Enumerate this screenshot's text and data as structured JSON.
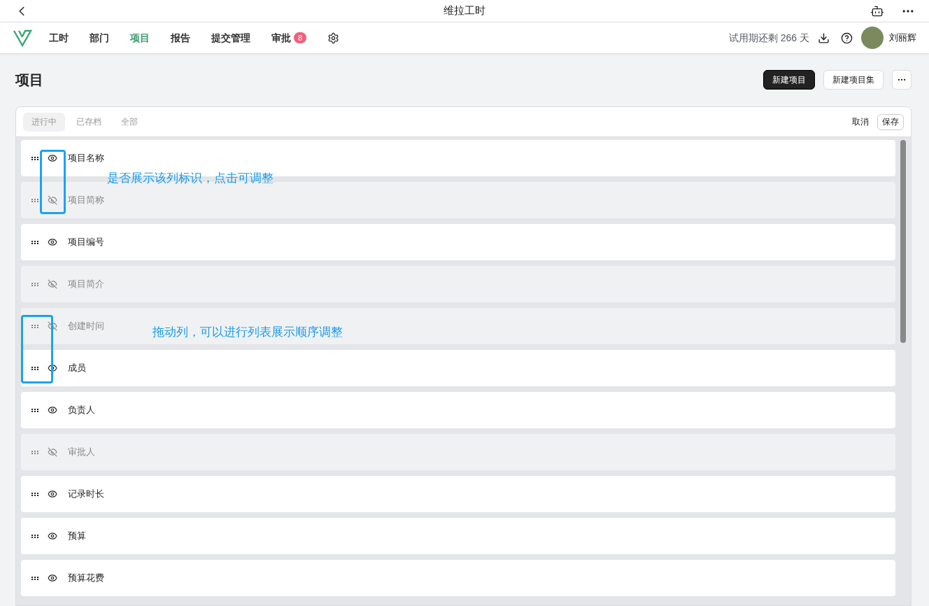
{
  "title_bar": {
    "title": "维拉工时"
  },
  "nav": {
    "items": [
      {
        "label": "工时",
        "selected": false
      },
      {
        "label": "部门",
        "selected": false
      },
      {
        "label": "项目",
        "selected": true
      },
      {
        "label": "报告",
        "selected": false
      },
      {
        "label": "提交管理",
        "selected": false
      },
      {
        "label": "审批",
        "selected": false,
        "badge": "8"
      }
    ],
    "trial": "试用期还剩 266 天",
    "user": "刘丽辉"
  },
  "page": {
    "title": "项目",
    "buttons": [
      {
        "label": "新建项目",
        "kind": "primary"
      },
      {
        "label": "新建项目集",
        "kind": "secondary"
      }
    ]
  },
  "card": {
    "tabs": [
      {
        "label": "进行中",
        "selected": true
      },
      {
        "label": "已存档",
        "selected": false
      },
      {
        "label": "全部",
        "selected": false
      }
    ],
    "cancel": "取消",
    "save": "保存",
    "columns": [
      {
        "label": "项目名称",
        "visible": true
      },
      {
        "label": "项目简称",
        "visible": false
      },
      {
        "label": "项目编号",
        "visible": true
      },
      {
        "label": "项目简介",
        "visible": false
      },
      {
        "label": "创建时间",
        "visible": false
      },
      {
        "label": "成员",
        "visible": true
      },
      {
        "label": "负责人",
        "visible": true
      },
      {
        "label": "审批人",
        "visible": false
      },
      {
        "label": "记录时长",
        "visible": true
      },
      {
        "label": "预算",
        "visible": true
      },
      {
        "label": "预算花费",
        "visible": true
      }
    ]
  },
  "annotations": [
    {
      "text": "是否展示该列标识，点击可调整"
    },
    {
      "text": "拖动列，可以进行列表展示顺序调整"
    }
  ]
}
